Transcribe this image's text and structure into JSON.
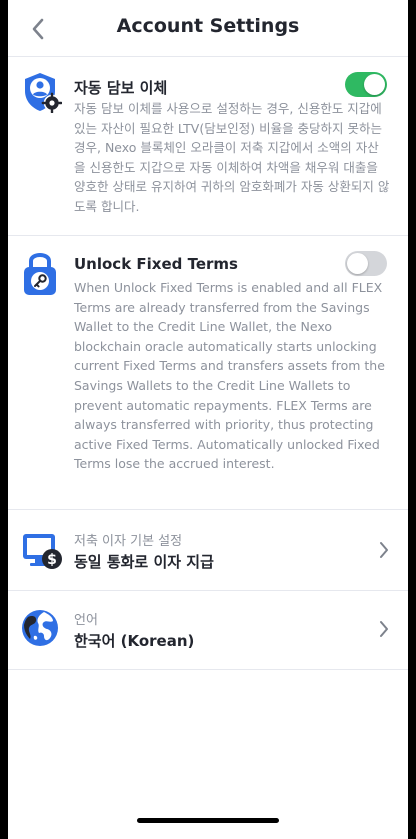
{
  "header": {
    "title": "Account Settings",
    "back_icon": "chevron-left-icon"
  },
  "auto_collateral": {
    "title": "자동 담보 이체",
    "description": "자동 담보 이체를 사용으로 설정하는 경우, 신용한도 지갑에 있는 자산이 필요한 LTV(담보인정) 비율을 충당하지 못하는 경우, Nexo 블록체인 오라클이 저축 지갑에서 소액의 자산을 신용한도 지갑으로 자동 이체하여 차액을 채우워 대출을 양호한 상태로 유지하여 귀하의 암호화폐가 자동 상환되지 않도록 합니다.",
    "enabled": true,
    "icon": "shield-user-gear-icon"
  },
  "unlock_fixed": {
    "title": "Unlock Fixed Terms",
    "description": "When Unlock Fixed Terms is enabled and all FLEX Terms are already transferred from the Savings Wallet to the Credit Line Wallet, the Nexo blockchain oracle automatically starts unlocking current Fixed Terms and transfers assets from the Savings Wallets to the Credit Line Wallets to prevent automatic repayments. FLEX Terms are always transferred with priority, thus protecting active Fixed Terms. Automatically unlocked Fixed Terms lose the accrued interest.",
    "enabled": false,
    "icon": "padlock-key-icon"
  },
  "interest": {
    "label": "저축 이자 기본 설정",
    "value": "동일 통화로 이자 지급",
    "icon": "monitor-dollar-icon"
  },
  "language": {
    "label": "언어",
    "value": "한국어 (Korean)",
    "icon": "globe-icon"
  },
  "colors": {
    "accent_blue": "#2f6fe4",
    "toggle_on": "#2fb962",
    "toggle_off": "#d4d6da"
  }
}
